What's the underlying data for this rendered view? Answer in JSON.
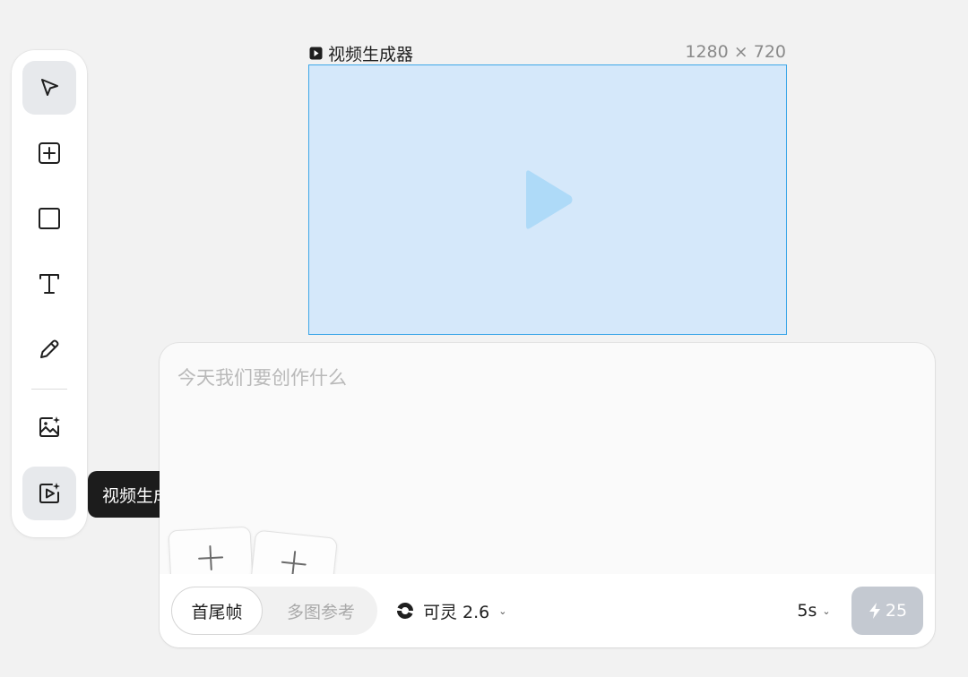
{
  "toolbar": {
    "tools": [
      {
        "name": "select-tool",
        "icon": "cursor-arrow-icon"
      },
      {
        "name": "add-frame-tool",
        "icon": "plus-square-icon"
      },
      {
        "name": "rectangle-tool",
        "icon": "square-icon"
      },
      {
        "name": "text-tool",
        "icon": "text-T-icon"
      },
      {
        "name": "pen-tool",
        "icon": "pencil-icon"
      },
      {
        "name": "image-generator-tool",
        "icon": "image-sparkle-icon"
      },
      {
        "name": "video-generator-tool",
        "icon": "video-sparkle-icon"
      }
    ],
    "tooltip": "视频生成器"
  },
  "frame": {
    "label": "视频生成器",
    "size": "1280 × 720",
    "icon": "play-square-icon"
  },
  "prompt": {
    "placeholder": "今天我们要创作什么",
    "value": ""
  },
  "bottom_bar": {
    "mode_active": "首尾帧",
    "mode_inactive": "多图参考",
    "model_name": "可灵 2.6",
    "duration": "5s",
    "credits": "25"
  },
  "colors": {
    "frame_fill": "#d5e8fa",
    "frame_border": "#3ea7e8",
    "play_icon": "#aedaf8",
    "tooltip_bg": "#1c1c1c",
    "generate_disabled": "#c4c9d1"
  }
}
